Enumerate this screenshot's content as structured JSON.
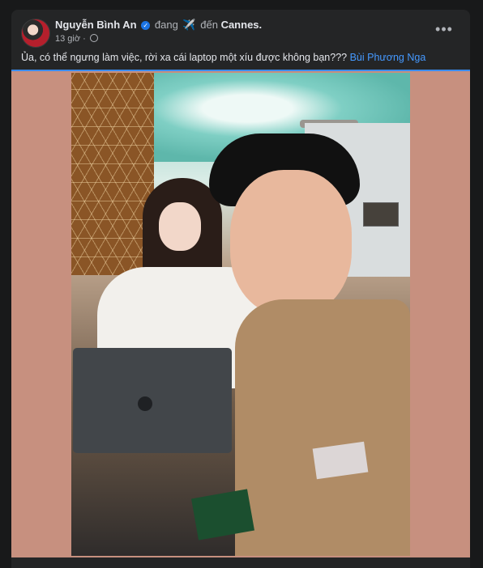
{
  "post": {
    "author": "Nguyễn Bình An",
    "activity": "đang",
    "activity_emoji": "✈️",
    "preposition": "đến",
    "destination": "Cannes.",
    "time": "13 giờ",
    "privacy_icon": "globe-icon",
    "more_label": "•••",
    "caption": "Ủa, có thể ngưng làm việc, rời xa cái laptop một xíu được không bạn???",
    "mention": "Bùi Phương Nga"
  },
  "colors": {
    "background": "#18191a",
    "card": "#242526",
    "accent": "#1b74e4",
    "mention": "#4599ff",
    "photo_bg": "#c7907f"
  }
}
